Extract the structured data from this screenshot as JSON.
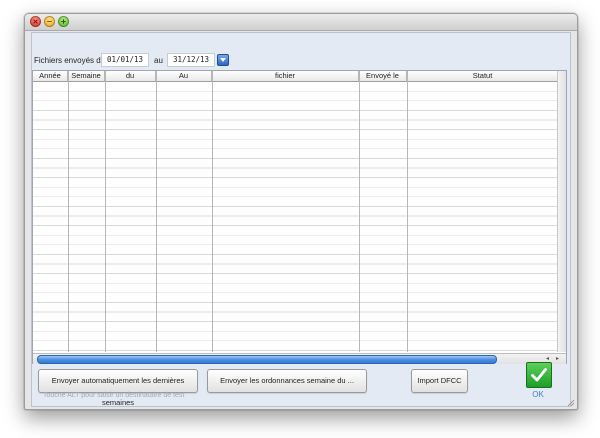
{
  "filter": {
    "label": "Fichiers envoyés du",
    "from_date": "01/01/13",
    "to_label": "au",
    "to_date": "31/12/13"
  },
  "table": {
    "columns": [
      "Année",
      "Semaine",
      "du",
      "Au",
      "fichier",
      "Envoyé le",
      "Statut"
    ],
    "rows": []
  },
  "buttons": {
    "send_auto": "Envoyer automatiquement les dernières semaines",
    "send_week": "Envoyer les ordonnances semaine du ...",
    "import_dfcc": "Import DFCC"
  },
  "hint": "Touche ALT pour saisir un destinataire de test",
  "ok": {
    "label": "OK",
    "icon": "checkmark-icon",
    "color": "#2aa63a"
  },
  "colors": {
    "accent": "#3d7fd6",
    "scroll_thumb": "#4d8fe0"
  }
}
